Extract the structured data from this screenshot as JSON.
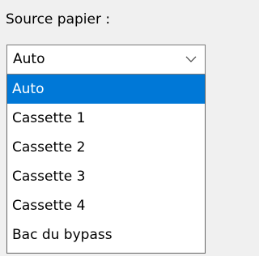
{
  "field": {
    "label": "Source papier :"
  },
  "combo": {
    "value": "Auto",
    "chevron_icon": "chevron-down-icon"
  },
  "dropdown": {
    "selected_index": 0,
    "options": [
      {
        "label": "Auto"
      },
      {
        "label": "Cassette 1"
      },
      {
        "label": "Cassette 2"
      },
      {
        "label": "Cassette 3"
      },
      {
        "label": "Cassette 4"
      },
      {
        "label": "Bac du bypass"
      }
    ]
  },
  "colors": {
    "highlight": "#0078d7",
    "highlight_text": "#ffffff",
    "background": "#f0f0f0",
    "border": "#7a7a7a"
  }
}
